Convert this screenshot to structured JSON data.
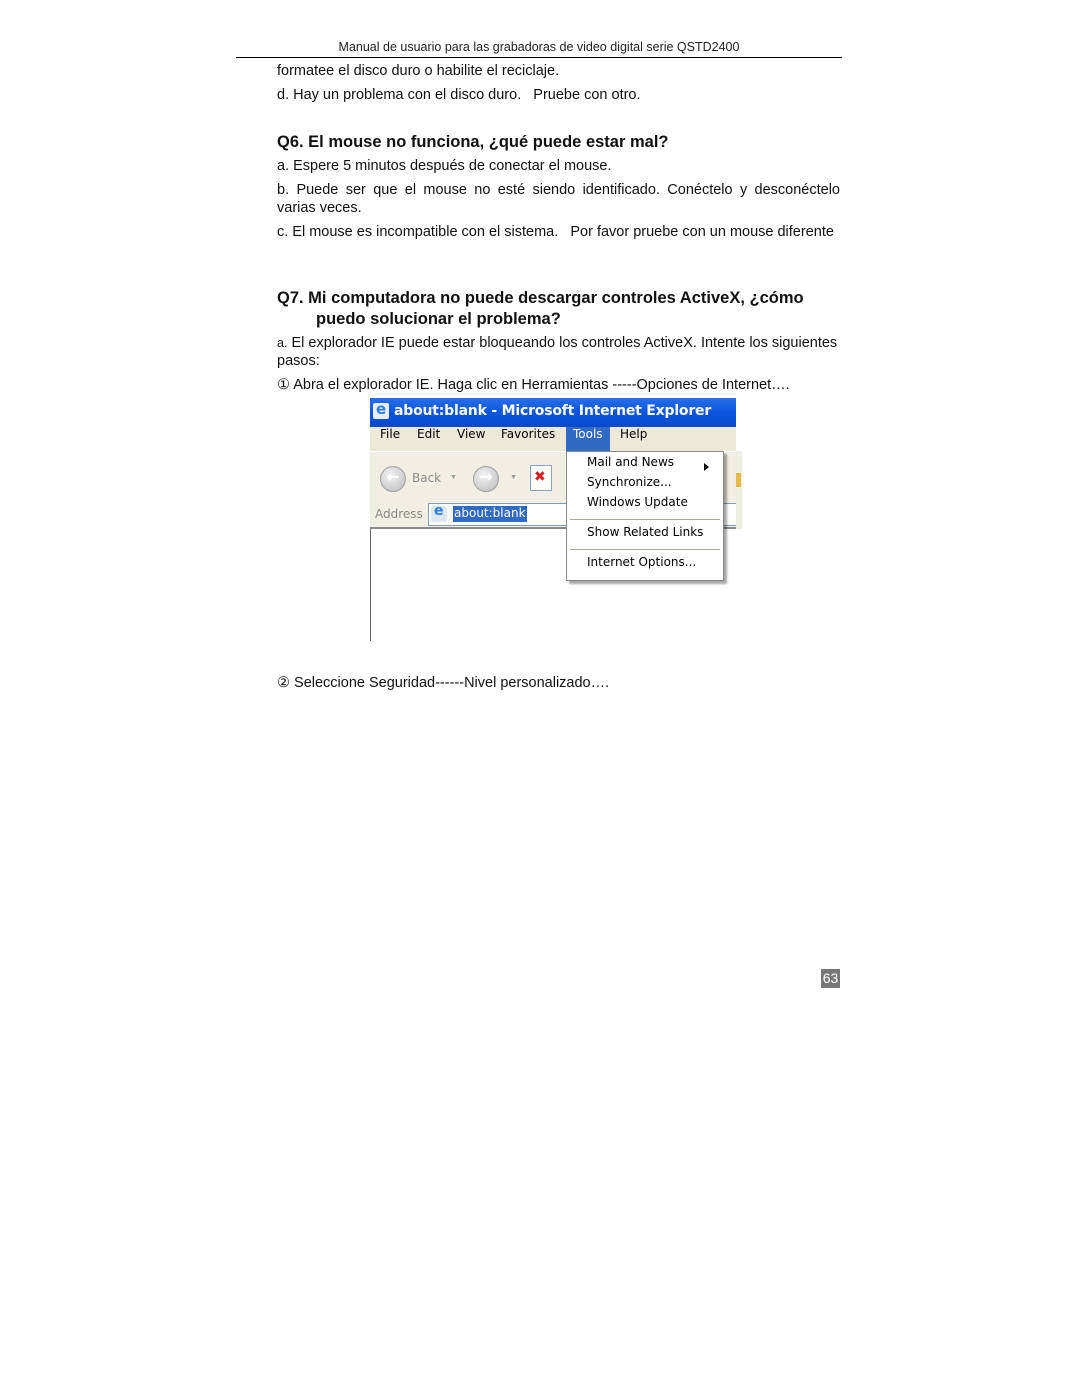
{
  "header": {
    "title": "Manual de usuario para las grabadoras de video digital serie QSTD2400"
  },
  "content": {
    "intro_continuation": "formatee el disco duro o habilite el reciclaje.",
    "intro_item_d": "d. Hay un problema con el disco duro.   Pruebe con otro.",
    "q6": {
      "heading": "Q6. El mouse no funciona, ¿qué puede estar mal?",
      "items": [
        "a. Espere 5 minutos después de conectar el mouse.",
        "b. Puede ser que el mouse no esté siendo identificado. Conéctelo y desconéctelo varias veces.",
        "c. El mouse es incompatible con el sistema.   Por favor pruebe con un mouse diferente"
      ]
    },
    "q7": {
      "heading_line1": "Q7. Mi computadora no puede descargar controles ActiveX, ¿cómo",
      "heading_line2": "puedo solucionar el problema?",
      "item_a_prefix": "a.",
      "item_a": " El explorador IE puede estar bloqueando los controles ActiveX. Intente los siguientes pasos:",
      "step1": "① Abra el explorador IE. Haga clic en Herramientas -----Opciones de Internet….",
      "step2": "②  Seleccione Seguridad------Nivel personalizado…."
    }
  },
  "screenshot": {
    "window_title": "about:blank - Microsoft Internet Explorer",
    "menu": [
      "File",
      "Edit",
      "View",
      "Favorites",
      "Tools",
      "Help"
    ],
    "active_menu": "Tools",
    "toolbar": {
      "back_label": "Back",
      "back_icon": "arrow-left-icon",
      "forward_icon": "arrow-right-icon",
      "stop_icon": "stop-icon"
    },
    "address": {
      "label": "Address",
      "value": "about:blank"
    },
    "tools_menu": {
      "items": [
        "Mail and News",
        "Synchronize...",
        "Windows Update",
        "Show Related Links",
        "Internet Options..."
      ]
    },
    "colors": {
      "title_bar": "#0a55de",
      "menu_highlight": "#316ac5",
      "menu_bar": "#ece9d8"
    }
  },
  "footer": {
    "page_number": "63"
  }
}
